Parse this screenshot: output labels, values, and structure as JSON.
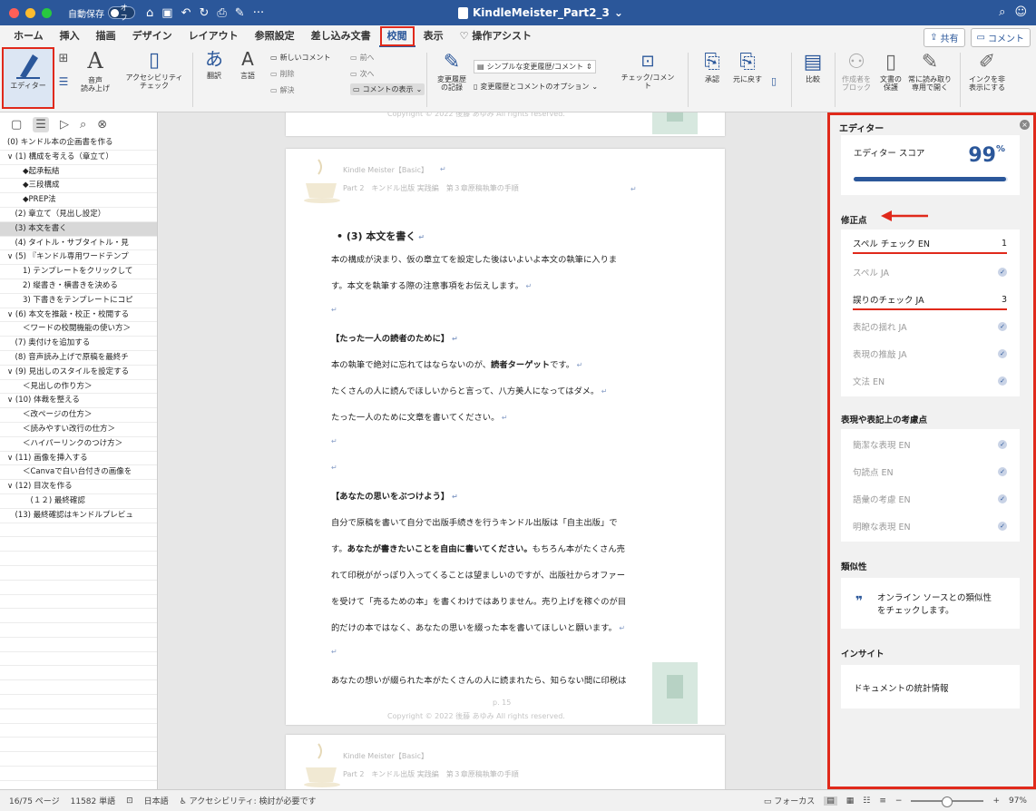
{
  "titlebar": {
    "autosave_label": "自動保存",
    "autosave_state": "オフ",
    "document_title": "KindleMeister_Part2_3",
    "accent": "#2b579a"
  },
  "menu": {
    "tabs": [
      "ホーム",
      "挿入",
      "描画",
      "デザイン",
      "レイアウト",
      "参照設定",
      "差し込み文書",
      "校閲",
      "表示"
    ],
    "active_tab": "校閲",
    "assist": "操作アシスト",
    "share": "共有",
    "comment": "コメント"
  },
  "ribbon": {
    "editor": "エディター",
    "speech_top": "音声",
    "speech_bottom": "読み上げ",
    "access_top": "アクセシビリティ",
    "access_bottom": "チェック",
    "translate": "翻訳",
    "language": "言語",
    "new_comment": "新しいコメント",
    "delete": "削除",
    "resolve": "解決",
    "prev": "前へ",
    "next": "次へ",
    "show_comments": "コメントの表示",
    "track_top": "変更履歴",
    "track_bottom": "の記録",
    "simple_markup": "シンプルな変更履歴/コメント",
    "markup_options": "変更履歴とコメントのオプション",
    "check_comment": "チェック/コメント",
    "accept": "承認",
    "reject": "元に戻す",
    "compare": "比較",
    "block_authors_top": "作成者を",
    "block_authors_bottom": "ブロック",
    "protect_top": "文書の",
    "protect_bottom": "保護",
    "readonly_top": "常に読み取り",
    "readonly_bottom": "専用で開く",
    "ink_top": "インクを非",
    "ink_bottom": "表示にする"
  },
  "nav": {
    "items": [
      "(0) キンドル本の企画書を作る",
      "∨ (1) 構成を考える（章立て）",
      "　　◆起承転結",
      "　　◆三段構成",
      "　　◆PREP法",
      "　(2) 章立て（見出し設定）",
      "　(3) 本文を書く",
      "　(4) タイトル・サブタイトル・見",
      "∨ (5) 『キンドル専用ワードテンプ",
      "　　1) テンプレートをクリックして",
      "　　2) 縦書き・横書きを決める",
      "　　3) 下書きをテンプレートにコピ",
      "∨ (6) 本文を推敲・校正・校閲する",
      "　　＜ワードの校閲機能の使い方＞",
      "　(7) 奥付けを追加する",
      "　(8) 音声読み上げで原稿を最終チ",
      "∨ (9) 見出しのスタイルを設定する",
      "　　＜見出しの作り方＞",
      "∨ (10) 体裁を整える",
      "　　＜改ページの仕方＞",
      "　　＜読みやすい改行の仕方＞",
      "　　＜ハイパーリンクのつけ方＞",
      "∨ (11) 画像を挿入する",
      "　　＜Canvaで白い台付きの画像を",
      "∨ (12) 目次を作る",
      "　　　(１２) 最終確認",
      "　(13) 最終確認はキンドルプレビュ"
    ],
    "selected_index": 6
  },
  "document": {
    "copyright": "Copyright © 2022 後藤 あゆみ All rights reserved.",
    "header1": "Kindle Meister【Basic】",
    "header2": "Part 2　キンドル出版 実践編　第３章原稿執筆の手順",
    "heading": "(3) 本文を書く",
    "p1": "本の構成が決まり、仮の章立てを設定した後はいよいよ本文の執筆に入りま",
    "p2": "す。本文を執筆する際の注意事項をお伝えします。",
    "sub1": "【たった一人の読者のために】",
    "p3a": "本の執筆で絶対に忘れてはならないのが、",
    "p3b": "読者ターゲット",
    "p3c": "です。",
    "p4": "たくさんの人に読んでほしいからと言って、八方美人になってはダメ。",
    "p5": "たった一人のために文章を書いてください。",
    "sub2": "【あなたの思いをぶつけよう】",
    "p6": "自分で原稿を書いて自分で出版手続きを行うキンドル出版は「自主出版」で",
    "p7a": "す。",
    "p7b": "あなたが書きたいことを自由に書いてください。",
    "p7c": "もちろん本がたくさん売",
    "p8": "れて印税ががっぽり入ってくることは望ましいのですが、出版社からオファー",
    "p9": "を受けて「売るための本」を書くわけではありません。売り上げを稼ぐのが目",
    "p10": "的だけの本ではなく、あなたの思いを綴った本を書いてほしいと願います。",
    "p11": "あなたの想いが綴られた本がたくさんの人に読まれたら、知らない間に印税は",
    "page_num": "p. 15"
  },
  "editor": {
    "title": "エディター",
    "score_label": "エディター スコア",
    "score_value": "99",
    "score_unit": "%",
    "score_fraction": 0.99,
    "corrections_head": "修正点",
    "spell_en": "スペル チェック EN",
    "spell_en_count": "1",
    "spell_ja": "スペル JA",
    "grammar_ja": "誤りのチェック JA",
    "grammar_ja_count": "3",
    "notation": "表記の揺れ JA",
    "expression": "表現の推敲 JA",
    "grammar_en": "文法 EN",
    "refine_head": "表現や表記上の考慮点",
    "concise": "簡潔な表現 EN",
    "punct": "句読点 EN",
    "vocab": "語彙の考慮 EN",
    "clarity": "明瞭な表現 EN",
    "similarity_head": "類似性",
    "similarity_text1": "オンライン ソースとの類似性",
    "similarity_text2": "をチェックします。",
    "insights_head": "インサイト",
    "stats": "ドキュメントの統計情報"
  },
  "status": {
    "page": "16/75 ページ",
    "words": "11582 単語",
    "lang": "日本語",
    "access": "アクセシビリティ: 検討が必要です",
    "focus": "フォーカス",
    "zoom": "97%"
  }
}
